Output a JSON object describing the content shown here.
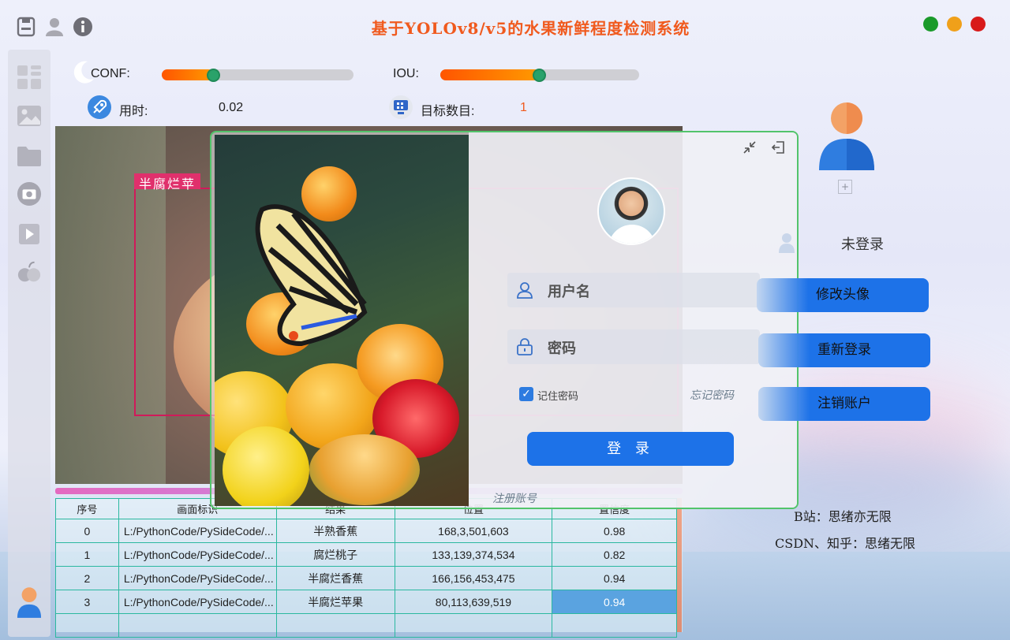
{
  "app": {
    "title": "基于YOLOv8/v5的水果新鲜程度检测系统",
    "window_buttons": {
      "green": "#1a9a2a",
      "yellow": "#f0a01a",
      "red": "#d81a1a"
    }
  },
  "top_icons": [
    "save-icon",
    "user-icon",
    "info-icon"
  ],
  "sidebar": {
    "items": [
      "dashboard-icon",
      "image-icon",
      "folder-icon",
      "camera-icon",
      "video-icon",
      "fruit-icon"
    ]
  },
  "controls": {
    "conf_label": "CONF:",
    "conf_value": 0.27,
    "iou_label": "IOU:",
    "iou_value": 0.5,
    "time_label": "用时:",
    "time_value": "0.02",
    "count_label": "目标数目:",
    "count_value": "1"
  },
  "detection": {
    "label": "半腐烂苹"
  },
  "table": {
    "headers": [
      "序号",
      "画面标识",
      "结果",
      "位置",
      "置信度"
    ],
    "rows": [
      [
        "0",
        "L:/PythonCode/PySideCode/...",
        "半熟香蕉",
        "168,3,501,603",
        "0.98"
      ],
      [
        "1",
        "L:/PythonCode/PySideCode/...",
        "腐烂桃子",
        "133,139,374,534",
        "0.82"
      ],
      [
        "2",
        "L:/PythonCode/PySideCode/...",
        "半腐烂香蕉",
        "166,156,453,475",
        "0.94"
      ],
      [
        "3",
        "L:/PythonCode/PySideCode/...",
        "半腐烂苹果",
        "80,113,639,519",
        "0.94"
      ]
    ]
  },
  "login": {
    "username_placeholder": "用户名",
    "password_placeholder": "密码",
    "remember_label": "记住密码",
    "remember_checked": true,
    "forgot_label": "忘记密码",
    "login_button": "登 录",
    "register_link": "注册账号"
  },
  "account": {
    "status": "未登录",
    "change_avatar": "修改头像",
    "relogin": "重新登录",
    "logout": "注销账户",
    "plus": "+"
  },
  "credits": {
    "bilibili": "B站：思绪亦无限",
    "csdn": "CSDN、知乎：思绪无限"
  }
}
